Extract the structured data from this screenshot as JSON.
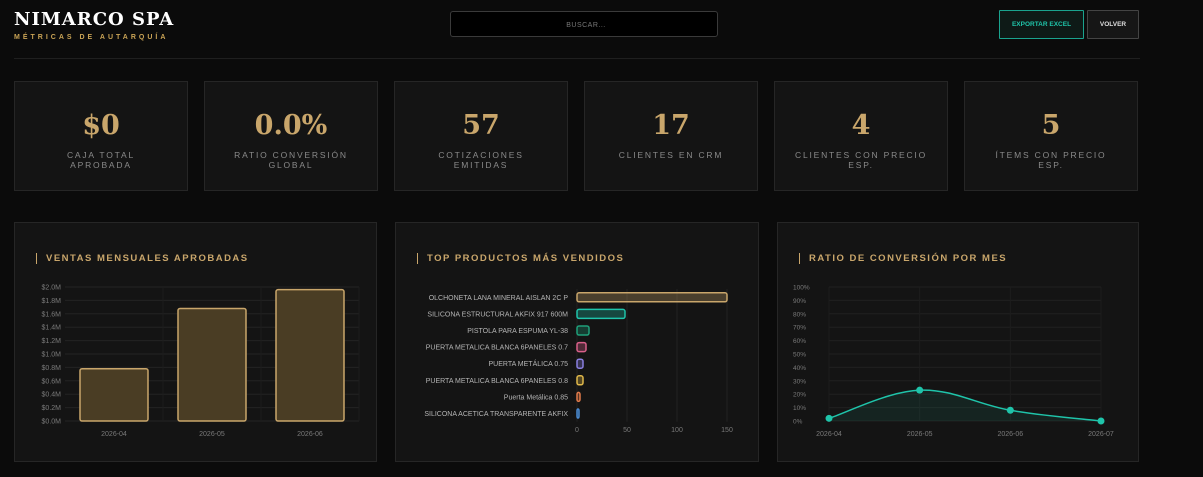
{
  "header": {
    "brand": "NIMARCO SPA",
    "subtitle": "MÉTRICAS DE AUTARQUÍA",
    "search_placeholder": "BUSCAR...",
    "export_label": "EXPORTAR EXCEL",
    "back_label": "VOLVER"
  },
  "colors": {
    "gold": "#c9a66b",
    "teal": "#1fc4aa",
    "background": "#0b0b0b",
    "card": "#141414"
  },
  "kpis": [
    {
      "value": "$0",
      "label": "CAJA TOTAL APROBADA"
    },
    {
      "value": "0.0%",
      "label": "RATIO CONVERSIÓN GLOBAL"
    },
    {
      "value": "57",
      "label": "COTIZACIONES EMITIDAS"
    },
    {
      "value": "17",
      "label": "CLIENTES EN CRM"
    },
    {
      "value": "4",
      "label": "CLIENTES CON PRECIO ESP."
    },
    {
      "value": "5",
      "label": "ÍTEMS CON PRECIO ESP."
    }
  ],
  "panels": {
    "sales_title": "VENTAS MENSUALES APROBADAS",
    "products_title": "TOP PRODUCTOS MÁS VENDIDOS",
    "conversion_title": "RATIO DE CONVERSIÓN POR MES"
  },
  "chart_data": [
    {
      "type": "bar",
      "categories": [
        "2026-04",
        "2026-05",
        "2026-06"
      ],
      "values": [
        0.78,
        1.68,
        1.96
      ],
      "unit": "M",
      "yticks": [
        "$0.0M",
        "$0.2M",
        "$0.4M",
        "$0.6M",
        "$0.8M",
        "$1.0M",
        "$1.2M",
        "$1.4M",
        "$1.6M",
        "$1.8M",
        "$2.0M"
      ],
      "ylim": [
        0,
        2.0
      ],
      "grid": true
    },
    {
      "type": "bar",
      "orientation": "horizontal",
      "categories": [
        "OLCHONETA LANA MINERAL AISLAN 2C P",
        "SILICONA ESTRUCTURAL AKFIX 917 600M",
        "PISTOLA PARA ESPUMA YL-38",
        "PUERTA METALICA BLANCA 6PANELES 0.7",
        "PUERTA METÁLICA 0.75",
        "PUERTA METALICA BLANCA 6PANELES 0.8",
        "Puerta Metálica 0.85",
        "SILICONA ACETICA TRANSPARENTE AKFIX"
      ],
      "values": [
        150,
        48,
        12,
        9,
        6,
        6,
        3,
        2
      ],
      "colors": [
        "#c9a66b",
        "#1fc4aa",
        "#1fa07a",
        "#d9608a",
        "#8a7fe0",
        "#e0b84a",
        "#e07a4a",
        "#4a8ad0"
      ],
      "xticks": [
        "0",
        "50",
        "100",
        "150"
      ],
      "xlim": [
        0,
        150
      ],
      "grid": true
    },
    {
      "type": "area",
      "categories": [
        "2026-04",
        "2026-05",
        "2026-06",
        "2026-07"
      ],
      "values": [
        2,
        23,
        8,
        0
      ],
      "yticks": [
        "0%",
        "10%",
        "20%",
        "30%",
        "40%",
        "50%",
        "60%",
        "70%",
        "80%",
        "90%",
        "100%"
      ],
      "ylim": [
        0,
        100
      ],
      "grid": true
    }
  ]
}
